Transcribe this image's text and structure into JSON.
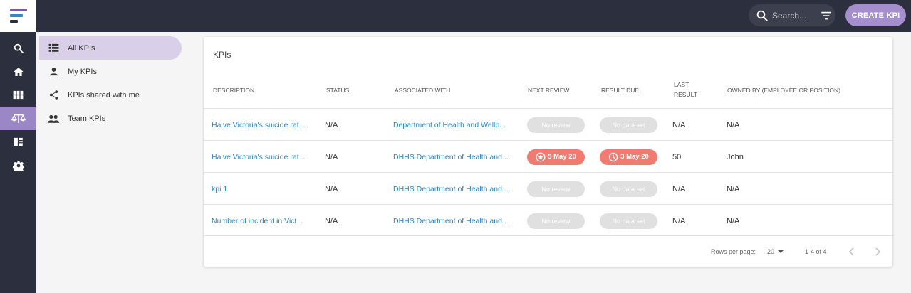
{
  "header": {
    "search_placeholder": "Search...",
    "create_label": "CREATE KPI"
  },
  "rail": {
    "icons": [
      "search-icon",
      "home-icon",
      "grid-icon",
      "scales-icon",
      "report-icon",
      "gear-icon"
    ],
    "active_index": 3,
    "active_color": "#9b86c6"
  },
  "subnav": {
    "items": [
      {
        "label": "All KPIs",
        "icon": "list-icon",
        "active": true
      },
      {
        "label": "My KPIs",
        "icon": "person-icon"
      },
      {
        "label": "KPIs shared with me",
        "icon": "share-icon"
      },
      {
        "label": "Team KPIs",
        "icon": "group-icon"
      }
    ]
  },
  "card": {
    "title": "KPIs",
    "columns": {
      "description": "DESCRIPTION",
      "status": "STATUS",
      "associated": "ASSOCIATED WITH",
      "next_review": "NEXT REVIEW",
      "result_due": "RESULT DUE",
      "last_result_1": "LAST",
      "last_result_2": "RESULT",
      "owned_by": "OWNED BY (EMPLOYEE OR POSITION)"
    },
    "rows": [
      {
        "description": "Halve Victoria's suicide rat...",
        "status": "N/A",
        "associated": "Department of Health and Wellb...",
        "next_review": "No review",
        "result_due": "No data set",
        "last_result": "N/A",
        "owned_by": "N/A"
      },
      {
        "description": "Halve Victoria's suicide rat...",
        "status": "N/A",
        "associated": "DHHS Department of Health and ...",
        "next_review": "5 May 20",
        "result_due": "3 May 20",
        "last_result": "50",
        "owned_by": "John"
      },
      {
        "description": "kpi 1",
        "status": "N/A",
        "associated": "DHHS Department of Health and ...",
        "next_review": "No review",
        "result_due": "No data set",
        "last_result": "N/A",
        "owned_by": "N/A"
      },
      {
        "description": "Number of incident in Vict...",
        "status": "N/A",
        "associated": "DHHS Department of Health and ...",
        "next_review": "No review",
        "result_due": "No data set",
        "last_result": "N/A",
        "owned_by": "N/A"
      }
    ],
    "footer": {
      "rows_per_page_label": "Rows per page:",
      "rows_per_page_value": "20",
      "range": "1-4 of 4"
    }
  },
  "colors": {
    "topbar": "#2c2f3d",
    "accent": "#a48fcc",
    "link": "#2a86c4",
    "overdue": "#f07b71"
  }
}
